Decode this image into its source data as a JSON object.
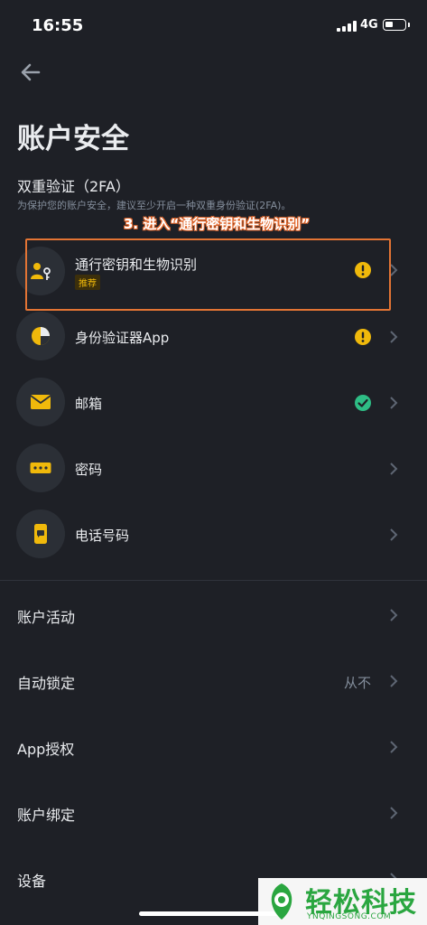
{
  "status_bar": {
    "time": "16:55",
    "network": "4G"
  },
  "header": {
    "back_icon": "arrow-left-icon",
    "title": "账户安全"
  },
  "twofa": {
    "title": "双重验证（2FA）",
    "description": "为保护您的账户安全，建议至少开启一种双重身份验证(2FA)。",
    "items": [
      {
        "label": "通行密钥和生物识别",
        "badge": "推荐",
        "icon": "passkey-person-icon",
        "status": "warning"
      },
      {
        "label": "身份验证器App",
        "icon": "authenticator-icon",
        "status": "warning"
      },
      {
        "label": "邮箱",
        "icon": "envelope-icon",
        "status": "success"
      },
      {
        "label": "密码",
        "icon": "password-dots-icon",
        "status": "none"
      },
      {
        "label": "电话号码",
        "icon": "phone-icon",
        "status": "none"
      }
    ]
  },
  "annotation": {
    "text": "3. 进入“通行密钥和生物识别”"
  },
  "menu": [
    {
      "label": "账户活动",
      "value": ""
    },
    {
      "label": "自动锁定",
      "value": "从不"
    },
    {
      "label": "App授权",
      "value": ""
    },
    {
      "label": "账户绑定",
      "value": ""
    },
    {
      "label": "设备",
      "value": ""
    }
  ],
  "watermark": {
    "text": "轻松科技",
    "sub": "YNQINGSONG.COM"
  },
  "colors": {
    "background": "#1e2026",
    "accent": "#f0b90b",
    "success": "#2ebd85",
    "annotation": "#e37434"
  }
}
